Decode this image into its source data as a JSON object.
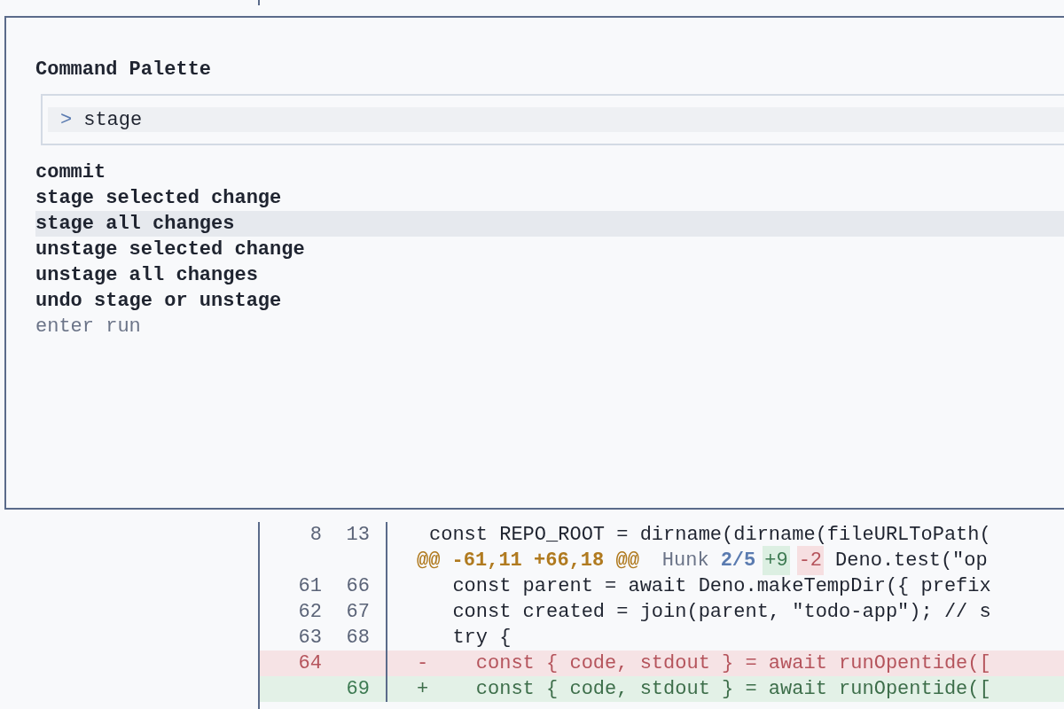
{
  "palette": {
    "title": "Command Palette",
    "input": {
      "prompt": ">",
      "value": "stage"
    },
    "items": [
      {
        "label": "commit",
        "selected": false
      },
      {
        "label": "stage selected change",
        "selected": false
      },
      {
        "label": "stage all changes",
        "selected": true
      },
      {
        "label": "unstage selected change",
        "selected": false
      },
      {
        "label": "unstage all changes",
        "selected": false
      },
      {
        "label": "undo stage or unstage",
        "selected": false
      }
    ],
    "hint": "enter run"
  },
  "diff": {
    "rows": [
      {
        "kind": "context",
        "old": "8",
        "new": "13",
        "code": "const REPO_ROOT = dirname(dirname(fileURLToPath("
      },
      {
        "kind": "hunk",
        "range": "@@ -61,11 +66,18 @@",
        "label": "Hunk",
        "index": "2/5",
        "added": "+9",
        "removed": "-2",
        "context": "Deno.test(\"op"
      },
      {
        "kind": "context",
        "old": "61",
        "new": "66",
        "code": "  const parent = await Deno.makeTempDir({ prefix"
      },
      {
        "kind": "context",
        "old": "62",
        "new": "67",
        "code": "  const created = join(parent, \"todo-app\"); // s"
      },
      {
        "kind": "context",
        "old": "63",
        "new": "68",
        "code": "  try {"
      },
      {
        "kind": "removed",
        "old": "64",
        "sign": "-",
        "code": "    const { code, stdout } = await runOpentide(["
      },
      {
        "kind": "added",
        "new": "69",
        "sign": "+",
        "code": "    const { code, stdout } = await runOpentide(["
      }
    ]
  }
}
